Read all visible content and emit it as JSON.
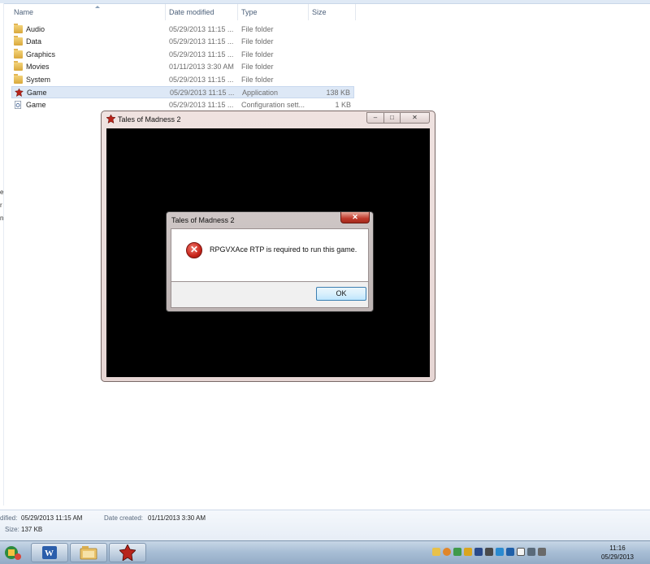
{
  "explorer": {
    "columns": [
      "Name",
      "Date modified",
      "Type",
      "Size"
    ],
    "files": [
      {
        "name": "Audio",
        "date": "05/29/2013 11:15 ...",
        "type": "File folder",
        "size": "",
        "icon": "folder-icon"
      },
      {
        "name": "Data",
        "date": "05/29/2013 11:15 ...",
        "type": "File folder",
        "size": "",
        "icon": "folder-icon"
      },
      {
        "name": "Graphics",
        "date": "05/29/2013 11:15 ...",
        "type": "File folder",
        "size": "",
        "icon": "folder-icon"
      },
      {
        "name": "Movies",
        "date": "01/11/2013 3:30 AM",
        "type": "File folder",
        "size": "",
        "icon": "folder-icon"
      },
      {
        "name": "System",
        "date": "05/29/2013 11:15 ...",
        "type": "File folder",
        "size": "",
        "icon": "folder-icon"
      },
      {
        "name": "Game",
        "date": "05/29/2013 11:15 ...",
        "type": "Application",
        "size": "138 KB",
        "icon": "game-exe-icon",
        "selected": true
      },
      {
        "name": "Game",
        "date": "05/29/2013 11:15 ...",
        "type": "Configuration sett...",
        "size": "1 KB",
        "icon": "config-file-icon"
      }
    ],
    "left_pane_cropped": [
      "e",
      "r",
      "n"
    ]
  },
  "game_window": {
    "title": "Tales of Madness 2",
    "buttons": {
      "minimize": "–",
      "maximize": "□",
      "close": "✕"
    }
  },
  "dialog": {
    "title": "Tales of Madness 2",
    "close": "✕",
    "message": "RPGVXAce RTP is required to run this game.",
    "ok_label": "OK",
    "icon": "error-icon"
  },
  "details": {
    "modified_label": "dified:",
    "modified_value": "05/29/2013 11:15 AM",
    "created_label": "Date created:",
    "created_value": "01/11/2013 3:30 AM",
    "size_label": "Size:",
    "size_value": "137 KB"
  },
  "taskbar": {
    "items": [
      "start-icon",
      "word-icon",
      "explorer-icon",
      "game-icon"
    ],
    "tray_icons": [
      "mail-icon",
      "messenger-icon",
      "network-app-icon",
      "shield-icon",
      "hardware-icon",
      "speaker-icon",
      "bluetooth-icon",
      "display-icon",
      "flag-icon",
      "network-icon",
      "volume-icon"
    ],
    "time": "11:16",
    "date": "05/29/2013"
  }
}
